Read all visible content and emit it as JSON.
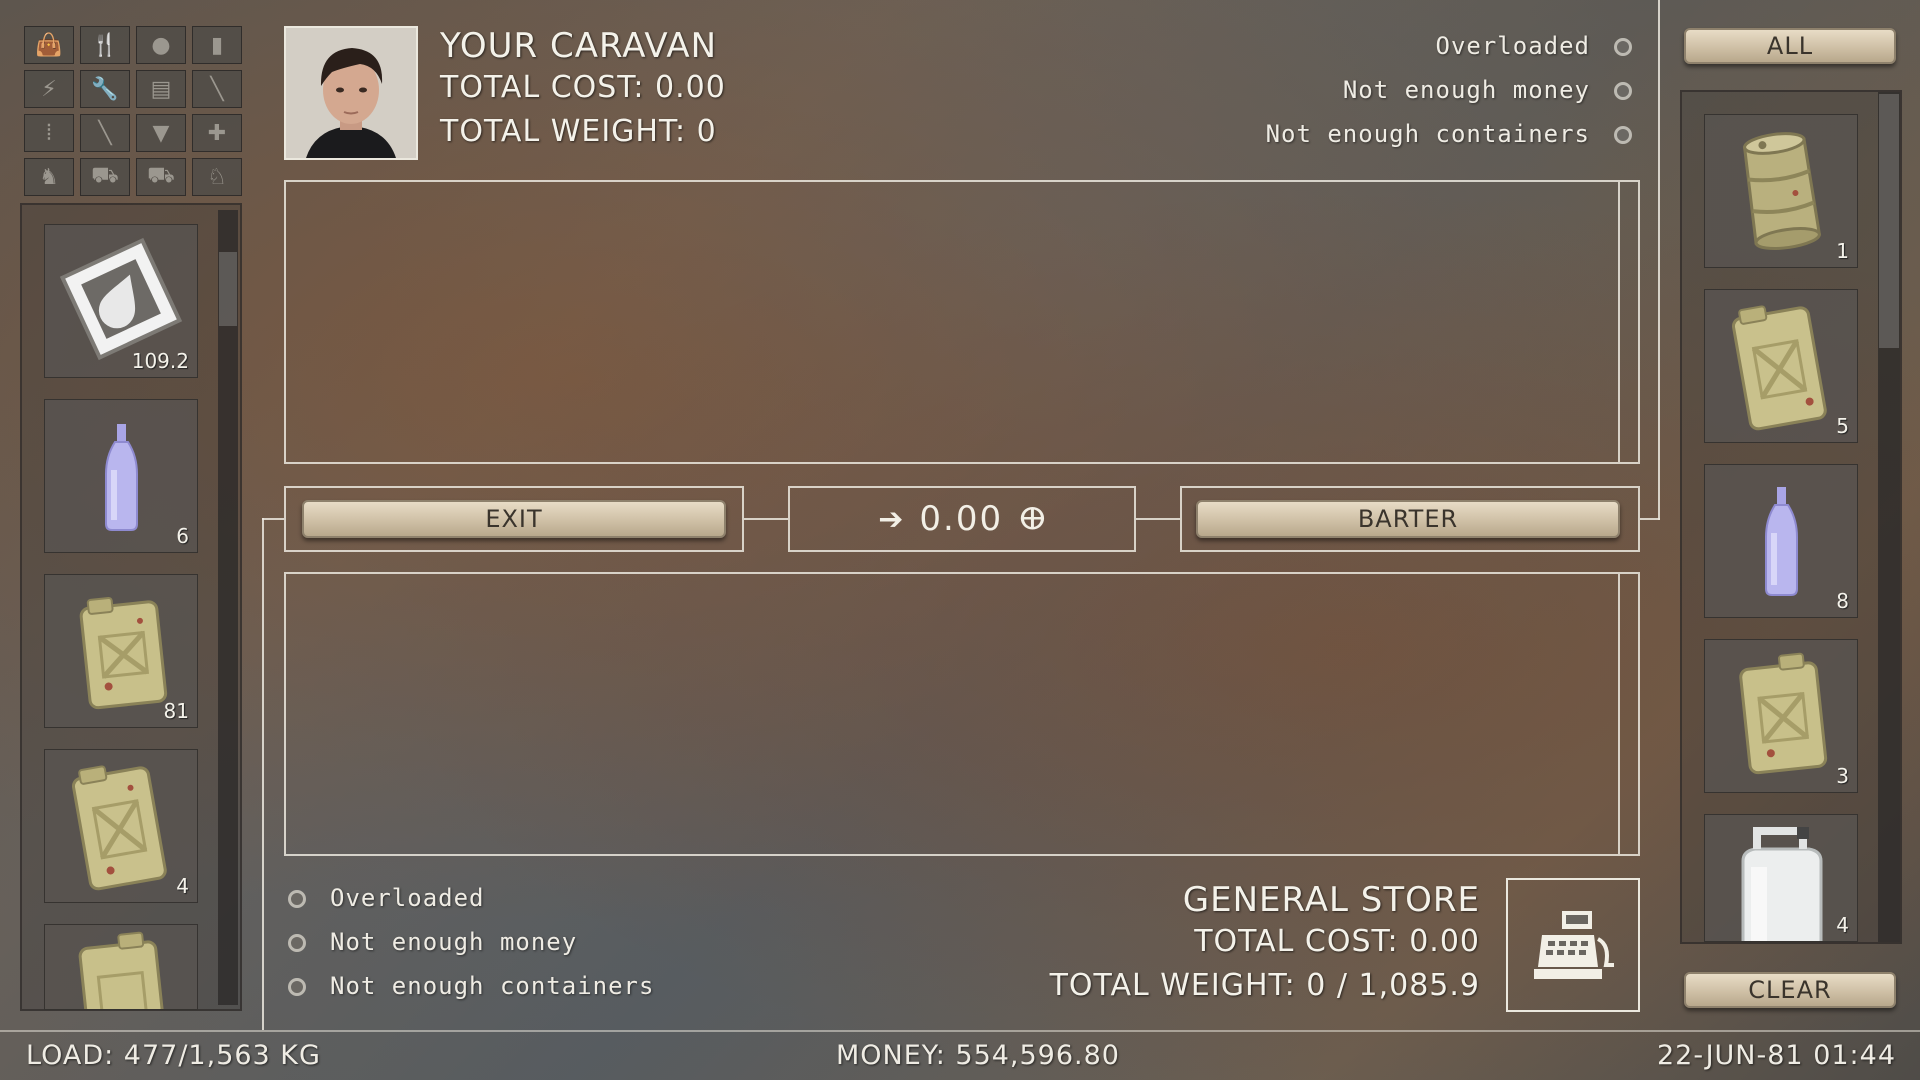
{
  "caravan": {
    "title": "YOUR CARAVAN",
    "total_cost": "TOTAL COST: 0.00",
    "total_weight": "TOTAL WEIGHT: 0",
    "status": [
      "Overloaded",
      "Not enough money",
      "Not enough containers"
    ]
  },
  "store": {
    "title": "GENERAL STORE",
    "total_cost": "TOTAL COST: 0.00",
    "total_weight": "TOTAL WEIGHT: 0 / 1,085.9",
    "status": [
      "Overloaded",
      "Not enough money",
      "Not enough containers"
    ]
  },
  "actions": {
    "exit_label": "EXIT",
    "barter_label": "BARTER",
    "balance": "0.00",
    "currency_symbol": "ⴲ",
    "all_label": "ALL",
    "clear_label": "CLEAR"
  },
  "left_inventory": [
    {
      "name": "water",
      "qty": "109.2"
    },
    {
      "name": "bottle",
      "qty": "6"
    },
    {
      "name": "jerrycan",
      "qty": "81"
    },
    {
      "name": "jerrycan",
      "qty": "4"
    },
    {
      "name": "jerrycan",
      "qty": ""
    }
  ],
  "right_inventory": [
    {
      "name": "barrel",
      "qty": "1"
    },
    {
      "name": "jerrycan",
      "qty": "5"
    },
    {
      "name": "bottle",
      "qty": "8"
    },
    {
      "name": "jerrycan",
      "qty": "3"
    },
    {
      "name": "white-canister",
      "qty": "4"
    }
  ],
  "categories": [
    "bag-icon",
    "fork-knife-icon",
    "drop-icon",
    "canister-icon",
    "lightning-icon",
    "wrench-icon",
    "box-icon",
    "tool-icon",
    "ammo-icon",
    "tool2-icon",
    "vest-icon",
    "medkit-icon",
    "horse-icon",
    "cart-icon",
    "truck-icon",
    "camel-icon"
  ],
  "footer": {
    "load": "LOAD: 477/1,563 KG",
    "money": "MONEY: 554,596.80",
    "datetime": "22-JUN-81 01:44"
  },
  "colors": {
    "frame": "#ebe8de",
    "button": "#d6c8ae",
    "bottle": "#b9b6ee",
    "jerrycan": "#c8c08a"
  }
}
